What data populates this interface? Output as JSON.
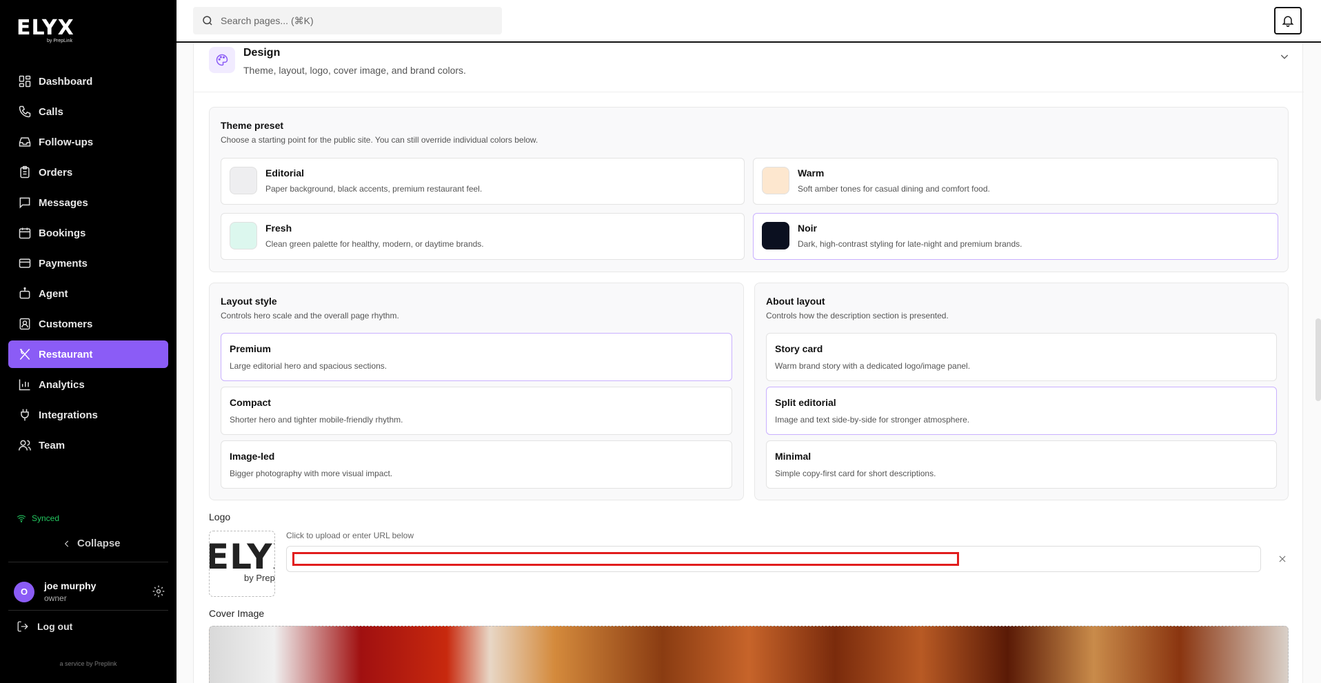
{
  "brand": {
    "name": "ELYX",
    "sub": "by PrepLink"
  },
  "sidebar": {
    "items": [
      {
        "label": "Dashboard",
        "icon": "dashboard-icon"
      },
      {
        "label": "Calls",
        "icon": "phone-icon"
      },
      {
        "label": "Follow-ups",
        "icon": "inbox-icon"
      },
      {
        "label": "Orders",
        "icon": "clipboard-icon"
      },
      {
        "label": "Messages",
        "icon": "chat-icon"
      },
      {
        "label": "Bookings",
        "icon": "calendar-icon"
      },
      {
        "label": "Payments",
        "icon": "card-icon"
      },
      {
        "label": "Agent",
        "icon": "bot-icon"
      },
      {
        "label": "Customers",
        "icon": "contact-icon"
      },
      {
        "label": "Restaurant",
        "icon": "utensils-icon",
        "active": true
      },
      {
        "label": "Analytics",
        "icon": "chart-icon"
      },
      {
        "label": "Integrations",
        "icon": "plug-icon"
      },
      {
        "label": "Team",
        "icon": "users-icon"
      }
    ],
    "status": "Synced",
    "collapse_label": "Collapse",
    "user": {
      "initial": "O",
      "name": "joe murphy",
      "role": "owner"
    },
    "logout_label": "Log out",
    "service_note": "a service by Preplink"
  },
  "topbar": {
    "search_placeholder": "Search pages... (⌘K)"
  },
  "design": {
    "title": "Design",
    "description": "Theme, layout, logo, cover image, and brand colors.",
    "theme": {
      "title": "Theme preset",
      "description": "Choose a starting point for the public site. You can still override individual colors below.",
      "options": [
        {
          "name": "Editorial",
          "desc": "Paper background, black accents, premium restaurant feel.",
          "swatch": "#eeeef0",
          "selected": false
        },
        {
          "name": "Warm",
          "desc": "Soft amber tones for casual dining and comfort food.",
          "swatch": "#fde7cf",
          "selected": false
        },
        {
          "name": "Fresh",
          "desc": "Clean green palette for healthy, modern, or daytime brands.",
          "swatch": "#dcf7ee",
          "selected": false
        },
        {
          "name": "Noir",
          "desc": "Dark, high-contrast styling for late-night and premium brands.",
          "swatch": "#0b1020",
          "selected": true
        }
      ]
    },
    "layout": {
      "title": "Layout style",
      "description": "Controls hero scale and the overall page rhythm.",
      "options": [
        {
          "name": "Premium",
          "desc": "Large editorial hero and spacious sections.",
          "selected": true
        },
        {
          "name": "Compact",
          "desc": "Shorter hero and tighter mobile-friendly rhythm.",
          "selected": false
        },
        {
          "name": "Image-led",
          "desc": "Bigger photography with more visual impact.",
          "selected": false
        }
      ]
    },
    "about": {
      "title": "About layout",
      "description": "Controls how the description section is presented.",
      "options": [
        {
          "name": "Story card",
          "desc": "Warm brand story with a dedicated logo/image panel.",
          "selected": false
        },
        {
          "name": "Split editorial",
          "desc": "Image and text side-by-side for stronger atmosphere.",
          "selected": true
        },
        {
          "name": "Minimal",
          "desc": "Simple copy-first card for short descriptions.",
          "selected": false
        }
      ]
    },
    "logo": {
      "label": "Logo",
      "hint": "Click to upload or enter URL below",
      "preview_word": "ELYX",
      "preview_sub": "by PrepLink",
      "url_value": ""
    },
    "cover": {
      "label": "Cover Image"
    }
  },
  "colors": {
    "accent": "#8b5cf6",
    "selected_border": "#c9b0ff",
    "synced": "#22c55e",
    "highlight": "#e11d1d"
  }
}
